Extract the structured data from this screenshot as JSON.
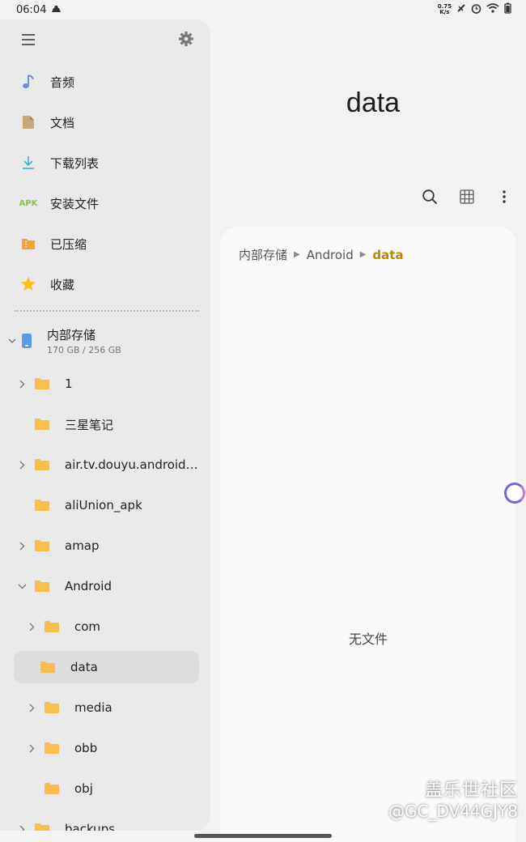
{
  "status_bar": {
    "time": "06:04",
    "net_speed_value": "0.75",
    "net_speed_unit": "K/s"
  },
  "sidebar": {
    "categories": [
      {
        "label": "音频",
        "icon": "music-note-icon"
      },
      {
        "label": "文档",
        "icon": "document-icon"
      },
      {
        "label": "下载列表",
        "icon": "download-icon"
      },
      {
        "label": "安装文件",
        "icon": "apk-icon",
        "icon_text": "APK"
      },
      {
        "label": "已压缩",
        "icon": "zip-icon"
      },
      {
        "label": "收藏",
        "icon": "star-icon"
      }
    ],
    "storage": {
      "name": "内部存储",
      "usage": "170 GB / 256 GB"
    },
    "tree": [
      {
        "label": "1"
      },
      {
        "label": "三星笔记"
      },
      {
        "label": "air.tv.douyu.android_Kc..."
      },
      {
        "label": "aliUnion_apk"
      },
      {
        "label": "amap"
      },
      {
        "label": "Android"
      },
      {
        "label": "com"
      },
      {
        "label": "data"
      },
      {
        "label": "media"
      },
      {
        "label": "obb"
      },
      {
        "label": "obj"
      },
      {
        "label": "backups"
      }
    ]
  },
  "main": {
    "title": "data",
    "breadcrumb": [
      "内部存储",
      "Android",
      "data"
    ],
    "empty_message": "无文件"
  },
  "watermark": {
    "line1": "盖乐世社区",
    "line2": "@GC_DV44GJY8"
  },
  "colors": {
    "folder": "#f7bf4f",
    "accent": "#b88a00"
  }
}
